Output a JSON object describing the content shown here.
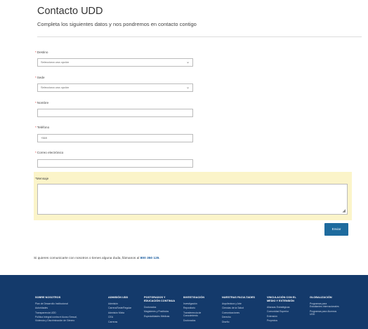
{
  "header": {
    "title": "Contacto UDD",
    "subtitle": "Completa los siguientes datos y nos pondremos en contacto contigo"
  },
  "form": {
    "required_mark": "*",
    "destino": {
      "label": "Destino",
      "value": "Selecciona una opción"
    },
    "sede": {
      "label": "Sede",
      "value": "Selecciona una opción"
    },
    "nombre": {
      "label": "Nombre",
      "value": ""
    },
    "telefono": {
      "label": "Teléfono",
      "value": "+569"
    },
    "correo": {
      "label": "Correo electrónico",
      "value": ""
    },
    "mensaje": {
      "label": "Mensaje",
      "value": ""
    },
    "dropdown_icon": "chevron-down-icon",
    "submit_label": "Enviar"
  },
  "contact_note": {
    "text": "Si quieres comunicarte con nosotros o tienes alguna duda, llámanos al ",
    "phone": "800 350 125",
    "end": "."
  },
  "colors": {
    "accent": "#1e6b9e",
    "footer_bg": "#143a6b",
    "highlight": "#fbf4c9"
  },
  "footer": {
    "columns": [
      {
        "heading": "SOBRE NOSOTROS",
        "items": [
          "Plan de Desarrollo Institucional",
          "Autoridades",
          "Transparencia UDD",
          "Política Integral contra el Acoso Sexual, Violencia y Discriminación de Género"
        ]
      },
      {
        "heading": "ADMISIÓN UDD",
        "items": [
          "Admisión",
          "Carrera/Sede/Regular",
          "Admisión Mixta",
          "CEA",
          "Carreras"
        ]
      },
      {
        "heading": "POSTGRADOS Y EDUCACIÓN CONTINUA",
        "items": [
          "Doctorados",
          "Magísteres y Postítulos",
          "Especialidades Médicas"
        ]
      },
      {
        "heading": "INVESTIGACIÓN",
        "items": [
          "Investigación",
          "Repositorio",
          "Transferencia de Conocimiento",
          "Doctorados"
        ]
      },
      {
        "heading": "NUESTRAS FACULTADES",
        "items": [
          "Arquitectura y Arte",
          "Ciencias de la Salud",
          "Comunicaciones",
          "Derecho",
          "Diseño"
        ]
      },
      {
        "heading": "VINCULACIÓN CON EL MEDIO Y EXTENSIÓN",
        "items": [
          "Alianzas Estratégicas",
          "Comunidad Superior",
          "Extensión",
          "Proyectos"
        ]
      },
      {
        "heading": "GLOBALIZACIÓN",
        "items": [
          "Programas para Estudiantes Internacionales",
          "Programas para Alumnos UDD"
        ]
      }
    ]
  }
}
